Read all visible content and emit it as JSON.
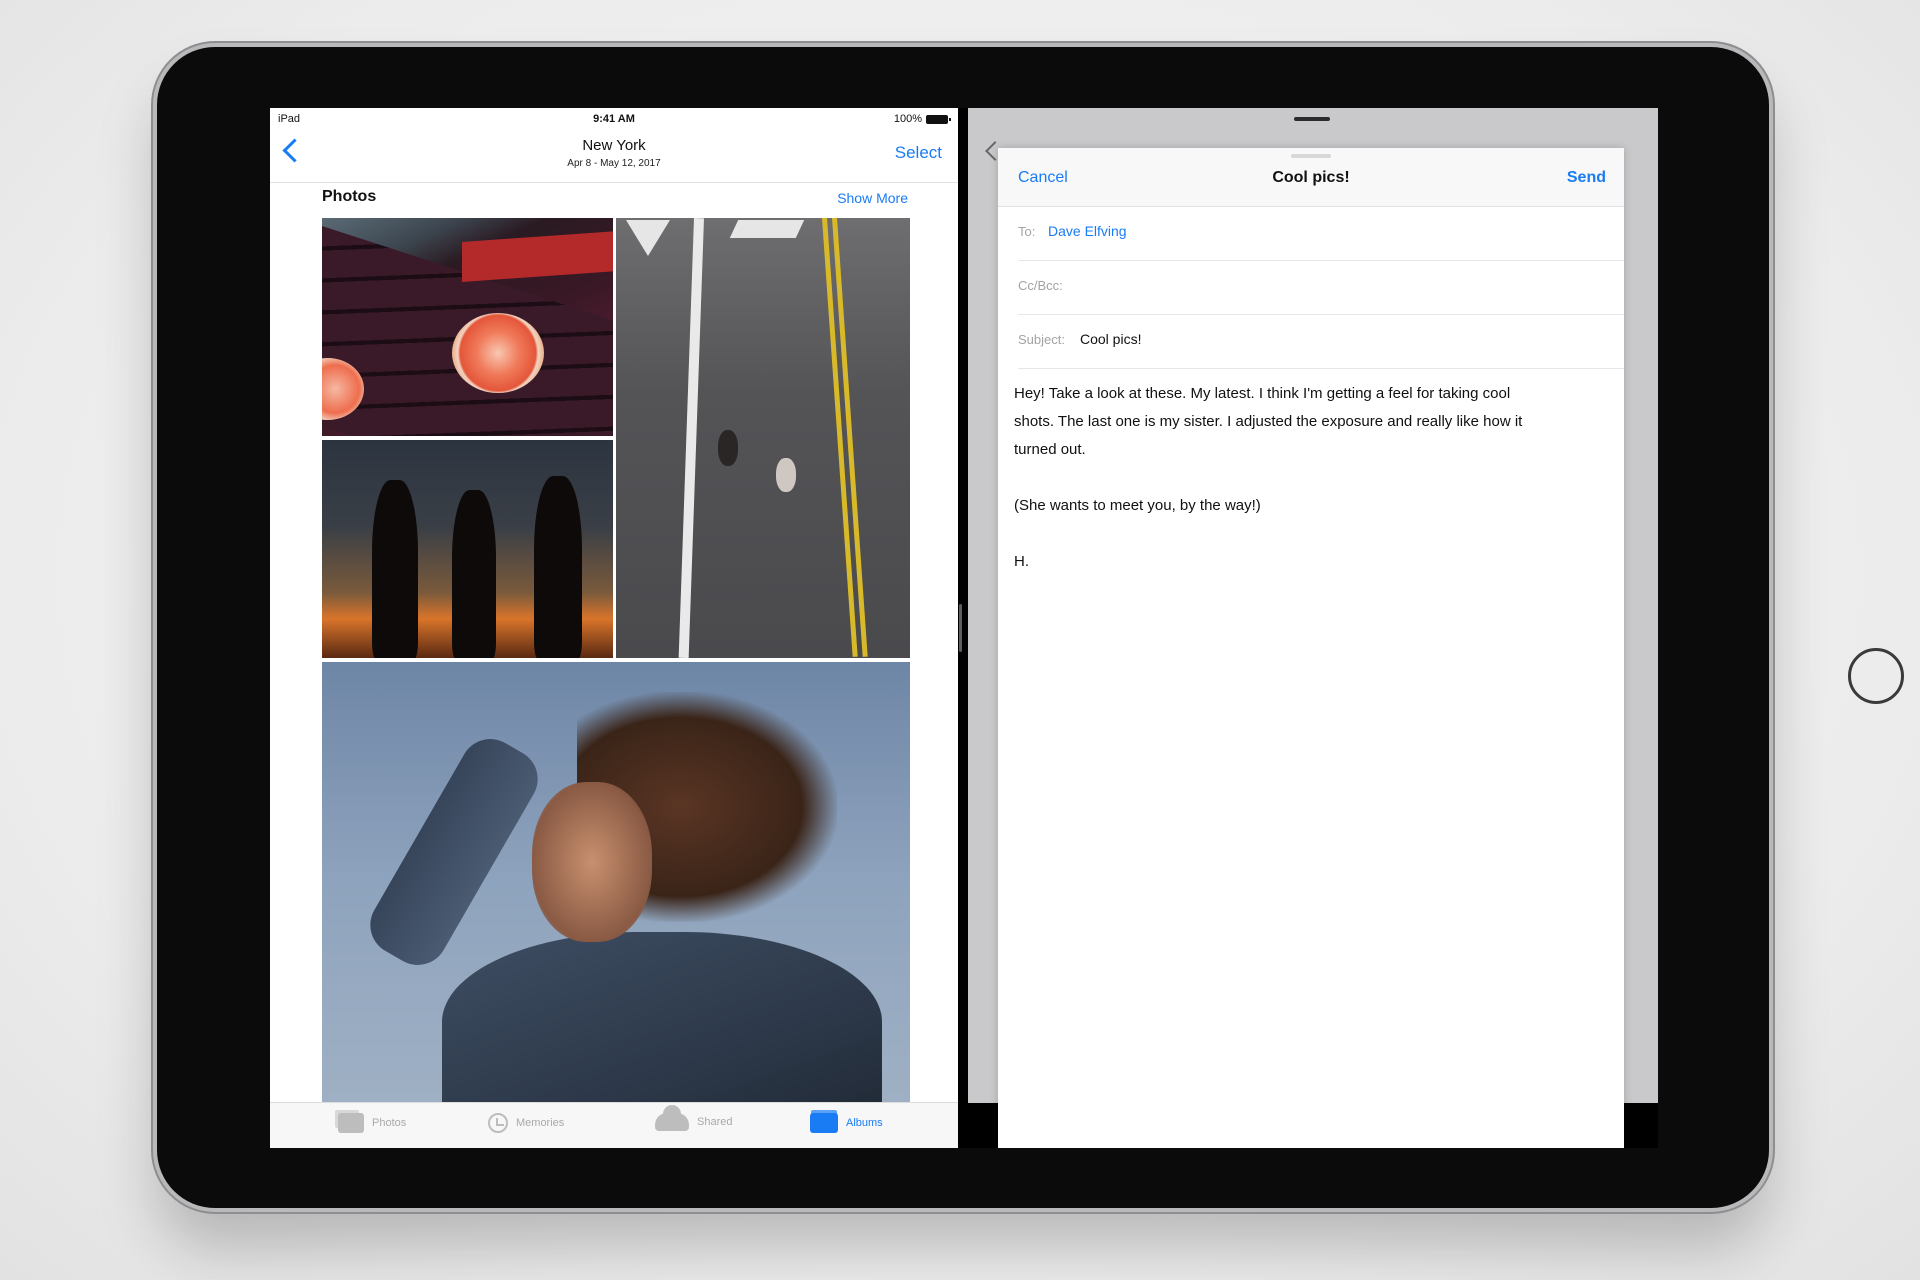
{
  "photos": {
    "status": {
      "device": "iPad",
      "time": "9:41 AM",
      "battery": "100%"
    },
    "nav": {
      "title": "New York",
      "subtitle": "Apr 8 - May 12, 2017",
      "select_label": "Select"
    },
    "section": {
      "title": "Photos",
      "show_more_label": "Show More"
    },
    "tabs": [
      {
        "label": "Photos",
        "icon": "photos-icon"
      },
      {
        "label": "Memories",
        "icon": "memories-icon"
      },
      {
        "label": "Shared",
        "icon": "shared-icon"
      },
      {
        "label": "Albums",
        "icon": "albums-icon",
        "selected": true
      }
    ]
  },
  "mail": {
    "compose": {
      "cancel_label": "Cancel",
      "title": "Cool pics!",
      "send_label": "Send",
      "to_label": "To:",
      "to_value": "Dave Elfving",
      "cc_label": "Cc/Bcc:",
      "subject_label": "Subject:",
      "subject_value": "Cool pics!",
      "body": [
        "Hey! Take a look at these. My latest. I think I'm getting a feel for taking cool",
        "shots. The last one is my sister. I adjusted the exposure and really like how it",
        "turned out.",
        "",
        "(She wants to meet you, by the way!)",
        "",
        "H."
      ]
    }
  },
  "colors": {
    "accent": "#1a7cf5",
    "bezel": "#0b0b0b"
  }
}
